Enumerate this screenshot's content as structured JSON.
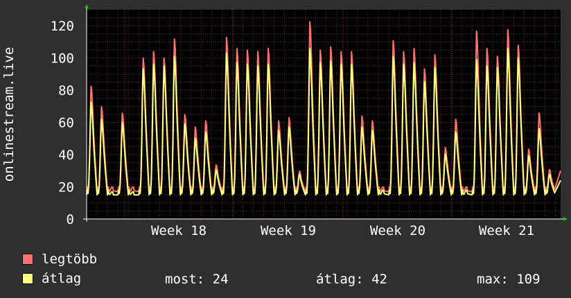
{
  "chart_data": {
    "type": "line",
    "ylabel": "onlinestream.live",
    "ylim": [
      0,
      130
    ],
    "yticks": [
      "0",
      "20",
      "40",
      "60",
      "80",
      "100",
      "120"
    ],
    "xticks": [
      "Week 18",
      "Week 19",
      "Week 20",
      "Week 21"
    ],
    "grid": true,
    "series": [
      {
        "name": "legtöbb",
        "color": "#ff7070",
        "daily_peaks": [
          84,
          71,
          20,
          67,
          20,
          102,
          106,
          102,
          114,
          66,
          58,
          62,
          34,
          115,
          108,
          107,
          106,
          108,
          62,
          64,
          30,
          125,
          107,
          109,
          106,
          106,
          65,
          62,
          20,
          113,
          106,
          108,
          95,
          104,
          45,
          63,
          20,
          119,
          108,
          103,
          120,
          110,
          44,
          67,
          31
        ]
      },
      {
        "name": "átlag",
        "color": "#ffff80",
        "daily_peaks": [
          74,
          63,
          17,
          61,
          17,
          95,
          98,
          97,
          103,
          60,
          51,
          55,
          31,
          105,
          99,
          98,
          97,
          98,
          56,
          58,
          28,
          108,
          99,
          100,
          98,
          98,
          58,
          56,
          18,
          103,
          98,
          99,
          87,
          96,
          41,
          55,
          18,
          101,
          97,
          96,
          108,
          102,
          40,
          57,
          28
        ]
      }
    ]
  },
  "legend": {
    "max_label": "legtöbb",
    "avg_label": "átlag"
  },
  "stats": {
    "current": "most: 24",
    "average": "átlag: 42",
    "maximum": "max: 109"
  }
}
